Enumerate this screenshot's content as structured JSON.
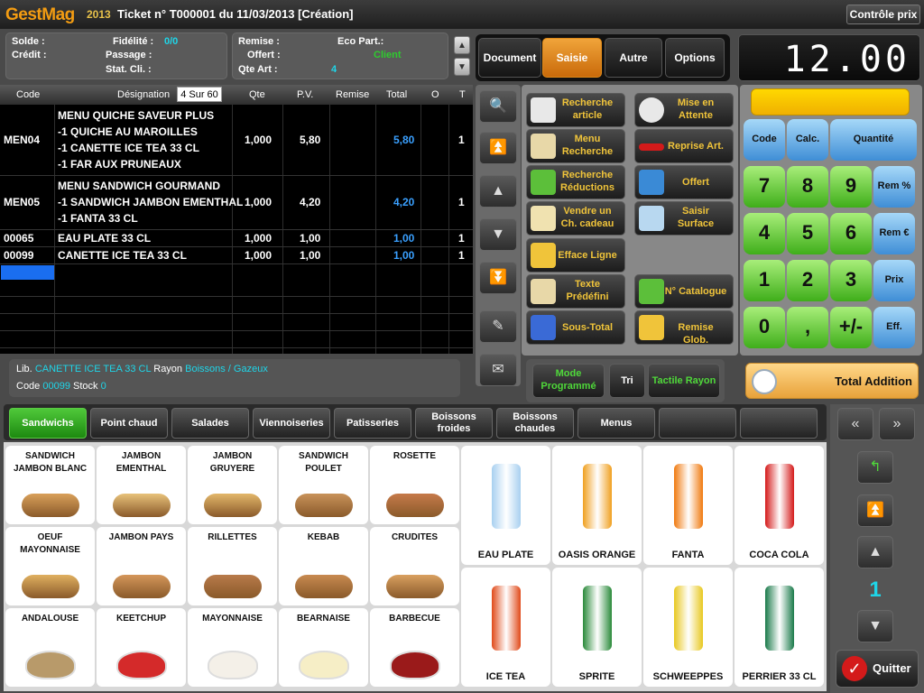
{
  "app": {
    "logo": "GestMag",
    "logo_year": "2013",
    "ticket_title": "Ticket n° T000001 du 11/03/2013  [Création]",
    "controle_prix": "Contrôle prix"
  },
  "info": {
    "solde_label": "Solde :",
    "credit_label": "Crédit :",
    "fidelite_label": "Fidélité :",
    "fidelite_value": "0/0",
    "passage_label": "Passage :",
    "stat_label": "Stat. Cli. :",
    "remise_label": "Remise :",
    "offert_label": "Offert :",
    "qte_art_label": "Qte Art :",
    "qte_art_value": "4",
    "eco_part_label": "Eco Part.:",
    "client_value": "Client"
  },
  "tabs": [
    "Document",
    "Saisie",
    "Autre",
    "Options"
  ],
  "active_tab": "Saisie",
  "display": {
    "total": "12.00"
  },
  "table": {
    "headers": {
      "code": "Code",
      "designation": "Désignation",
      "page": "4 Sur 60",
      "qte": "Qte",
      "pv": "P.V.",
      "remise": "Remise",
      "total": "Total",
      "o": "O",
      "t": "T"
    },
    "rows": [
      {
        "code": "MEN04",
        "lines": [
          "MENU QUICHE SAVEUR PLUS",
          "-1 QUICHE AU MAROILLES",
          "-1 CANETTE ICE TEA 33 CL",
          "-1 FAR AUX PRUNEAUX"
        ],
        "qte": "1,000",
        "pv": "5,80",
        "total": "5,80",
        "t": "1"
      },
      {
        "code": "MEN05",
        "lines": [
          "MENU SANDWICH GOURMAND",
          "-1 SANDWICH JAMBON EMENTHAL",
          "-1 FANTA 33 CL"
        ],
        "qte": "1,000",
        "pv": "4,20",
        "total": "4,20",
        "t": "1"
      },
      {
        "code": "00065",
        "lines": [
          "EAU PLATE 33 CL"
        ],
        "qte": "1,000",
        "pv": "1,00",
        "total": "1,00",
        "t": "1"
      },
      {
        "code": "00099",
        "lines": [
          "CANETTE ICE TEA 33 CL"
        ],
        "qte": "1,000",
        "pv": "1,00",
        "total": "1,00",
        "t": "1"
      }
    ]
  },
  "lib": {
    "lib_label": "Lib.",
    "lib_value": "CANETTE ICE TEA 33 CL",
    "rayon_label": "Rayon",
    "rayon_value": "Boissons / Gazeux",
    "code_label": "Code",
    "code_value": "00099",
    "stock_label": "Stock",
    "stock_value": "0"
  },
  "functions": {
    "left": [
      {
        "name": "recherche-article",
        "label": "Recherche article",
        "icon": "search-article-icon"
      },
      {
        "name": "menu-recherche",
        "label": "Menu Recherche",
        "icon": "menu-search-icon"
      },
      {
        "name": "recherche-reductions",
        "label": "Recherche Réductions",
        "icon": "discount-search-icon"
      },
      {
        "name": "vendre-cheque-cadeau",
        "label": "Vendre un Ch. cadeau",
        "icon": "gift-cheque-icon"
      },
      {
        "name": "efface-ligne",
        "label": "Efface Ligne",
        "icon": "erase-line-icon"
      },
      {
        "name": "texte-predefini",
        "label": "Texte Prédéfini",
        "icon": "text-icon"
      },
      {
        "name": "sous-total",
        "label": "Sous-Total",
        "icon": "calculator-icon"
      }
    ],
    "right": [
      {
        "name": "mise-en-attente",
        "label": "Mise en Attente",
        "icon": "clock-icon"
      },
      {
        "name": "reprise-art",
        "label": "Reprise Art.",
        "icon": "return-icon"
      },
      {
        "name": "offert",
        "label": "Offert",
        "icon": "gift-icon"
      },
      {
        "name": "saisir-surface",
        "label": "Saisir Surface",
        "icon": "cube-icon"
      },
      {
        "name": "no-catalogue",
        "label": "N° Catalogue",
        "icon": "catalogue-icon"
      },
      {
        "name": "remise-glob",
        "label": "Remise Glob.",
        "icon": "discount-star-icon"
      }
    ],
    "bottom": [
      "Mode Programmé",
      "Tri",
      "Tactile Rayon"
    ],
    "total_addition": "Total Addition"
  },
  "keypad": {
    "top": [
      "Code",
      "Calc.",
      "Quantité"
    ],
    "digits": [
      "7",
      "8",
      "9",
      "4",
      "5",
      "6",
      "1",
      "2",
      "3",
      "0",
      ",",
      "+/-"
    ],
    "side": [
      "Rem %",
      "Rem €",
      "Prix",
      "Eff."
    ]
  },
  "categories": [
    "Sandwichs",
    "Point chaud",
    "Salades",
    "Viennoiseries",
    "Patisseries",
    "Boissons froides",
    "Boissons chaudes",
    "Menus",
    "",
    ""
  ],
  "active_category": "Sandwichs",
  "products": [
    "SANDWICH JAMBON BLANC",
    "JAMBON EMENTHAL",
    "JAMBON GRUYERE",
    "SANDWICH POULET",
    "ROSETTE",
    "OEUF MAYONNAISE",
    "JAMBON PAYS",
    "RILLETTES",
    "KEBAB",
    "CRUDITES",
    "ANDALOUSE",
    "KEETCHUP",
    "MAYONNAISE",
    "BEARNAISE",
    "BARBECUE"
  ],
  "drinks": [
    "EAU PLATE",
    "OASIS ORANGE",
    "FANTA",
    "COCA COLA",
    "ICE TEA",
    "SPRITE",
    "SCHWEEPPES",
    "PERRIER 33 CL"
  ],
  "pager": {
    "page": "1",
    "quit": "Quitter"
  },
  "colors": {
    "accent": "#f0a43a",
    "cyan": "#1fd5e8",
    "green": "#3fae1a",
    "blue": "#3f8ed6"
  }
}
